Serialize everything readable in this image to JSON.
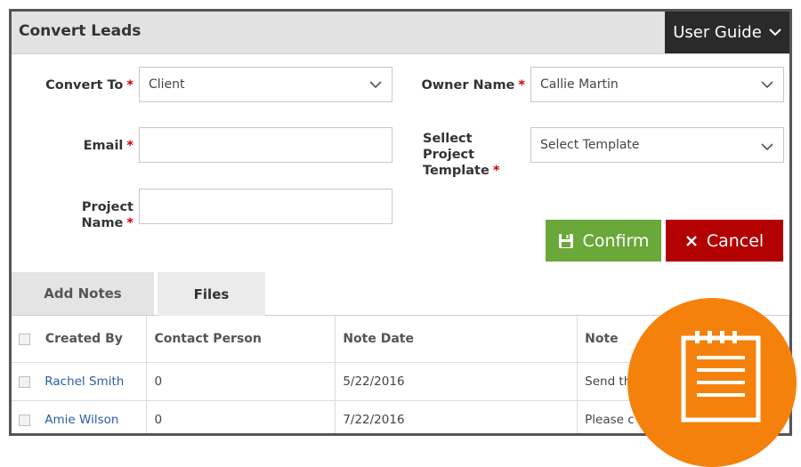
{
  "header": {
    "title": "Convert Leads",
    "user_guide_label": "User Guide"
  },
  "form": {
    "convert_to": {
      "label": "Convert To",
      "value": "Client"
    },
    "email": {
      "label": "Email",
      "value": ""
    },
    "project_name": {
      "label": "Project Name",
      "value": ""
    },
    "owner_name": {
      "label": "Owner Name",
      "value": "Callie Martin"
    },
    "project_template": {
      "label_line1": "Sellect Project",
      "label_line2": "Template",
      "value": "Select Template"
    },
    "required_marker": "*"
  },
  "actions": {
    "confirm_label": "Confirm",
    "cancel_label": "Cancel"
  },
  "tabs": [
    {
      "label": "Add Notes"
    },
    {
      "label": "Files"
    }
  ],
  "table": {
    "columns": [
      "Created By",
      "Contact Person",
      "Note Date",
      "Note"
    ],
    "rows": [
      {
        "created_by": "Rachel Smith",
        "contact_person": "0",
        "note_date": "5/22/2016",
        "note": "Send th"
      },
      {
        "created_by": "Amie Wilson",
        "contact_person": "0",
        "note_date": "7/22/2016",
        "note": "Please c"
      }
    ]
  },
  "colors": {
    "accent_orange": "#f5810d",
    "confirm_green": "#6aa839",
    "cancel_red": "#b30000",
    "link_blue": "#2b5ea7"
  },
  "icons": {
    "user_guide": "chevron-down-icon",
    "confirm": "floppy-disk-icon",
    "cancel": "close-icon",
    "badge": "notepad-icon"
  }
}
